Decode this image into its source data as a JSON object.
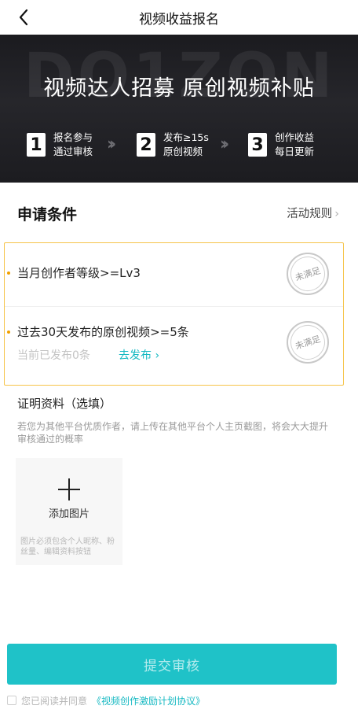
{
  "nav": {
    "title": "视频收益报名",
    "back_icon": "chevron-left-icon"
  },
  "banner": {
    "watermark": "DO1ZON",
    "headline": "视频达人招募 原创视频补贴",
    "steps": [
      {
        "num": "1",
        "line1": "报名参与",
        "line2": "通过审核"
      },
      {
        "num": "2",
        "line1": "发布≥15s",
        "line2": "原创视频"
      },
      {
        "num": "3",
        "line1": "创作收益",
        "line2": "每日更新"
      }
    ]
  },
  "conditions": {
    "title": "申请条件",
    "rules_link": "活动规则",
    "items": [
      {
        "text": "当月创作者等级>=Lv3",
        "stamp": "未满足"
      },
      {
        "text": "过去30天发布的原创视频>=5条",
        "sub": "当前已发布0条",
        "action": "去发布 ›",
        "stamp": "未满足"
      }
    ]
  },
  "proof": {
    "title": "证明资料（选填）",
    "desc": "若您为其他平台优质作者，请上传在其他平台个人主页截图，将会大大提升审核通过的概率",
    "upload_label": "添加图片",
    "upload_hint": "图片必须包含个人昵称、粉丝量、编辑资料按钮"
  },
  "submit": {
    "label": "提交审核"
  },
  "agreement": {
    "text": "您已阅读并同意",
    "link": "《视频创作激励计划协议》"
  },
  "colors": {
    "accent": "#1fc2c8",
    "link": "#16b9c2",
    "highlight_border": "#f6c44a",
    "banner_bg": "#1f1f23"
  }
}
